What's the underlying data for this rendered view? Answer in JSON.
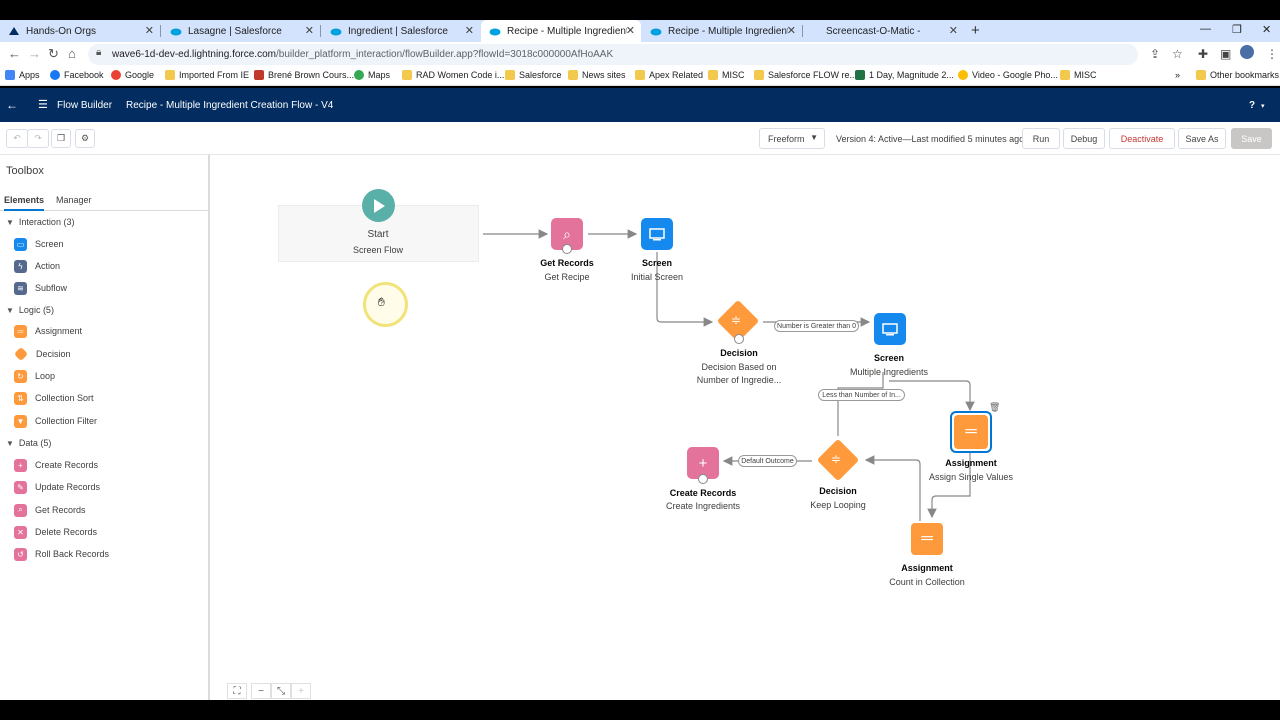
{
  "browser": {
    "tabs": [
      {
        "title": "Hands-On Orgs",
        "icon": "trailhead-icon"
      },
      {
        "title": "Lasagne | Salesforce",
        "icon": "salesforce-cloud-icon"
      },
      {
        "title": "Ingredient | Salesforce",
        "icon": "salesforce-cloud-icon"
      },
      {
        "title": "Recipe - Multiple Ingredient Crea",
        "icon": "salesforce-cloud-icon",
        "active": true
      },
      {
        "title": "Recipe - Multiple Ingredient Crea",
        "icon": "salesforce-cloud-icon"
      },
      {
        "title": "Screencast-O-Matic -",
        "icon": "screencast-icon"
      }
    ],
    "new_tab": "+",
    "url_host": "wave6-1d-dev-ed.lightning.force.com",
    "url_path": "/builder_platform_interaction/flowBuilder.app?flowId=3018c000000AfHoAAK",
    "bookmarks": [
      "Apps",
      "Facebook",
      "Google",
      "Imported From IE",
      "Brené Brown Cours...",
      "Maps",
      "RAD Women Code i...",
      "Salesforce",
      "News sites",
      "Apex Related",
      "MISC",
      "Salesforce FLOW re...",
      "1 Day, Magnitude 2...",
      "Video - Google Pho...",
      "MISC"
    ],
    "more_bookmarks": "»",
    "other_bookmarks": "Other bookmarks"
  },
  "header": {
    "app_name": "Flow Builder",
    "flow_title": "Recipe - Multiple Ingredient Creation Flow - V4",
    "help": "?"
  },
  "toolbar": {
    "layout_select": "Freeform",
    "version_info": "Version 4: Active—Last modified 5 minutes ago",
    "run": "Run",
    "debug": "Debug",
    "deactivate": "Deactivate",
    "save_as": "Save As",
    "save": "Save"
  },
  "toolbox": {
    "title": "Toolbox",
    "tab_elements": "Elements",
    "tab_manager": "Manager",
    "groups": [
      {
        "label": "Interaction (3)",
        "items": [
          "Screen",
          "Action",
          "Subflow"
        ]
      },
      {
        "label": "Logic (5)",
        "items": [
          "Assignment",
          "Decision",
          "Loop",
          "Collection Sort",
          "Collection Filter"
        ]
      },
      {
        "label": "Data (5)",
        "items": [
          "Create Records",
          "Update Records",
          "Get Records",
          "Delete Records",
          "Roll Back Records"
        ]
      }
    ]
  },
  "canvas": {
    "start": {
      "title": "Start",
      "subtitle": "Screen Flow"
    },
    "nodes": [
      {
        "type": "Get Records",
        "label": "Get Recipe"
      },
      {
        "type": "Screen",
        "label": "Initial Screen"
      },
      {
        "type": "Decision",
        "label": "Decision Based on",
        "label2": "Number of Ingredie..."
      },
      {
        "type": "Screen",
        "label": "Multiple Ingredients"
      },
      {
        "type": "Assignment",
        "label": "Assign Single Values"
      },
      {
        "type": "Decision",
        "label": "Keep Looping"
      },
      {
        "type": "Create Records",
        "label": "Create Ingredients"
      },
      {
        "type": "Assignment",
        "label": "Count in Collection"
      }
    ],
    "connector_labels": [
      "Number is Greater than 0",
      "Less than Number of In...",
      "Default Outcome"
    ]
  },
  "colors": {
    "header_bg": "#032d60",
    "screen_blue": "#1589ee",
    "logic_orange": "#ff9a3c",
    "data_pink": "#e3739b",
    "start_teal": "#58b0a9",
    "deactivate_red": "#c23934"
  }
}
